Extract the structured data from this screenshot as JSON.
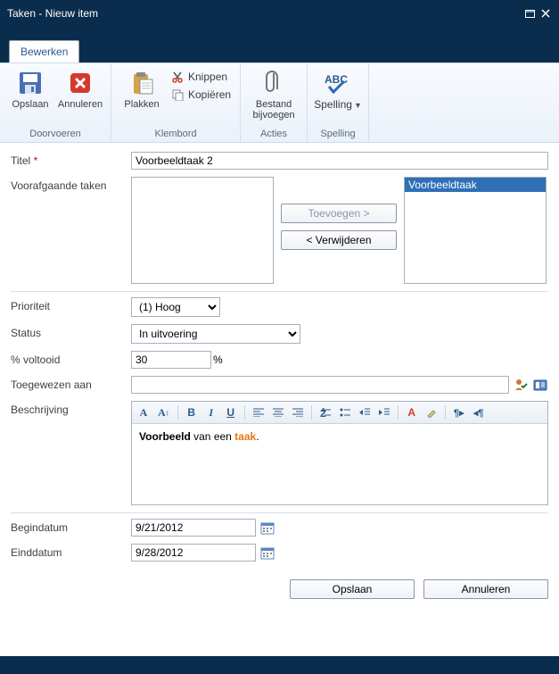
{
  "window": {
    "title": "Taken - Nieuw item"
  },
  "tabs": {
    "edit": "Bewerken"
  },
  "ribbon": {
    "save": "Opslaan",
    "cancel": "Annuleren",
    "group_commit": "Doorvoeren",
    "paste": "Plakken",
    "cut": "Knippen",
    "copy": "Kopiëren",
    "group_clipboard": "Klembord",
    "attach": "Bestand bijvoegen",
    "group_actions": "Acties",
    "spelling": "Spelling",
    "group_spelling": "Spelling"
  },
  "form": {
    "title_label": "Titel",
    "title_value": "Voorbeeldtaak 2",
    "preceding_label": "Voorafgaande taken",
    "preceding_available": [],
    "preceding_selected": [
      "Voorbeeldtaak"
    ],
    "add_btn": "Toevoegen >",
    "remove_btn": "< Verwijderen",
    "priority_label": "Prioriteit",
    "priority_value": "(1) Hoog",
    "status_label": "Status",
    "status_value": "In uitvoering",
    "percent_label": "% voltooid",
    "percent_value": "30",
    "percent_suffix": "%",
    "assigned_label": "Toegewezen aan",
    "assigned_value": "",
    "desc_label": "Beschrijving",
    "desc_prefix": "Voorbeeld",
    "desc_mid": " van een ",
    "desc_highlight": "taak",
    "desc_suffix": ".",
    "startdate_label": "Begindatum",
    "startdate_value": "9/21/2012",
    "enddate_label": "Einddatum",
    "enddate_value": "9/28/2012"
  },
  "footer": {
    "save": "Opslaan",
    "cancel": "Annuleren"
  }
}
